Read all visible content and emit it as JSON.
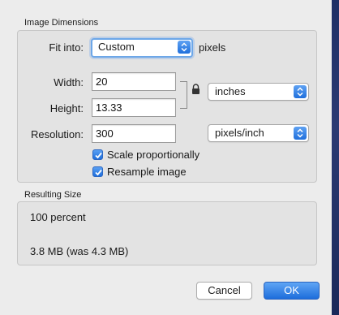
{
  "dimensions": {
    "section_title": "Image Dimensions",
    "fit_into": {
      "label": "Fit into:",
      "value": "Custom",
      "unit": "pixels"
    },
    "width": {
      "label": "Width:",
      "value": "20"
    },
    "height": {
      "label": "Height:",
      "value": "13.33"
    },
    "size_unit": {
      "value": "inches"
    },
    "resolution": {
      "label": "Resolution:",
      "value": "300",
      "unit_value": "pixels/inch"
    },
    "scale_proportionally": {
      "label": "Scale proportionally",
      "checked": true
    },
    "resample_image": {
      "label": "Resample image",
      "checked": true
    }
  },
  "result": {
    "section_title": "Resulting Size",
    "percent": "100 percent",
    "file_size": "3.8 MB (was 4.3 MB)"
  },
  "buttons": {
    "cancel": "Cancel",
    "ok": "OK"
  },
  "colors": {
    "accent": "#1f6fdc",
    "focus_ring": "#6da7e8",
    "dialog_bg": "#ececec"
  }
}
